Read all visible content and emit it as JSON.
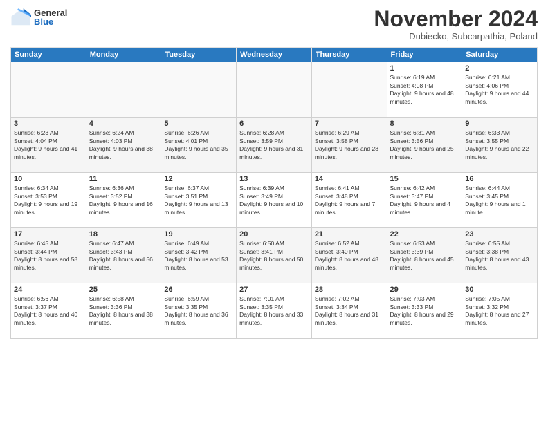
{
  "logo": {
    "general": "General",
    "blue": "Blue"
  },
  "title": "November 2024",
  "subtitle": "Dubiecko, Subcarpathia, Poland",
  "days_header": [
    "Sunday",
    "Monday",
    "Tuesday",
    "Wednesday",
    "Thursday",
    "Friday",
    "Saturday"
  ],
  "weeks": [
    [
      {
        "day": "",
        "content": ""
      },
      {
        "day": "",
        "content": ""
      },
      {
        "day": "",
        "content": ""
      },
      {
        "day": "",
        "content": ""
      },
      {
        "day": "",
        "content": ""
      },
      {
        "day": "1",
        "content": "Sunrise: 6:19 AM\nSunset: 4:08 PM\nDaylight: 9 hours and 48 minutes."
      },
      {
        "day": "2",
        "content": "Sunrise: 6:21 AM\nSunset: 4:06 PM\nDaylight: 9 hours and 44 minutes."
      }
    ],
    [
      {
        "day": "3",
        "content": "Sunrise: 6:23 AM\nSunset: 4:04 PM\nDaylight: 9 hours and 41 minutes."
      },
      {
        "day": "4",
        "content": "Sunrise: 6:24 AM\nSunset: 4:03 PM\nDaylight: 9 hours and 38 minutes."
      },
      {
        "day": "5",
        "content": "Sunrise: 6:26 AM\nSunset: 4:01 PM\nDaylight: 9 hours and 35 minutes."
      },
      {
        "day": "6",
        "content": "Sunrise: 6:28 AM\nSunset: 3:59 PM\nDaylight: 9 hours and 31 minutes."
      },
      {
        "day": "7",
        "content": "Sunrise: 6:29 AM\nSunset: 3:58 PM\nDaylight: 9 hours and 28 minutes."
      },
      {
        "day": "8",
        "content": "Sunrise: 6:31 AM\nSunset: 3:56 PM\nDaylight: 9 hours and 25 minutes."
      },
      {
        "day": "9",
        "content": "Sunrise: 6:33 AM\nSunset: 3:55 PM\nDaylight: 9 hours and 22 minutes."
      }
    ],
    [
      {
        "day": "10",
        "content": "Sunrise: 6:34 AM\nSunset: 3:53 PM\nDaylight: 9 hours and 19 minutes."
      },
      {
        "day": "11",
        "content": "Sunrise: 6:36 AM\nSunset: 3:52 PM\nDaylight: 9 hours and 16 minutes."
      },
      {
        "day": "12",
        "content": "Sunrise: 6:37 AM\nSunset: 3:51 PM\nDaylight: 9 hours and 13 minutes."
      },
      {
        "day": "13",
        "content": "Sunrise: 6:39 AM\nSunset: 3:49 PM\nDaylight: 9 hours and 10 minutes."
      },
      {
        "day": "14",
        "content": "Sunrise: 6:41 AM\nSunset: 3:48 PM\nDaylight: 9 hours and 7 minutes."
      },
      {
        "day": "15",
        "content": "Sunrise: 6:42 AM\nSunset: 3:47 PM\nDaylight: 9 hours and 4 minutes."
      },
      {
        "day": "16",
        "content": "Sunrise: 6:44 AM\nSunset: 3:45 PM\nDaylight: 9 hours and 1 minute."
      }
    ],
    [
      {
        "day": "17",
        "content": "Sunrise: 6:45 AM\nSunset: 3:44 PM\nDaylight: 8 hours and 58 minutes."
      },
      {
        "day": "18",
        "content": "Sunrise: 6:47 AM\nSunset: 3:43 PM\nDaylight: 8 hours and 56 minutes."
      },
      {
        "day": "19",
        "content": "Sunrise: 6:49 AM\nSunset: 3:42 PM\nDaylight: 8 hours and 53 minutes."
      },
      {
        "day": "20",
        "content": "Sunrise: 6:50 AM\nSunset: 3:41 PM\nDaylight: 8 hours and 50 minutes."
      },
      {
        "day": "21",
        "content": "Sunrise: 6:52 AM\nSunset: 3:40 PM\nDaylight: 8 hours and 48 minutes."
      },
      {
        "day": "22",
        "content": "Sunrise: 6:53 AM\nSunset: 3:39 PM\nDaylight: 8 hours and 45 minutes."
      },
      {
        "day": "23",
        "content": "Sunrise: 6:55 AM\nSunset: 3:38 PM\nDaylight: 8 hours and 43 minutes."
      }
    ],
    [
      {
        "day": "24",
        "content": "Sunrise: 6:56 AM\nSunset: 3:37 PM\nDaylight: 8 hours and 40 minutes."
      },
      {
        "day": "25",
        "content": "Sunrise: 6:58 AM\nSunset: 3:36 PM\nDaylight: 8 hours and 38 minutes."
      },
      {
        "day": "26",
        "content": "Sunrise: 6:59 AM\nSunset: 3:35 PM\nDaylight: 8 hours and 36 minutes."
      },
      {
        "day": "27",
        "content": "Sunrise: 7:01 AM\nSunset: 3:35 PM\nDaylight: 8 hours and 33 minutes."
      },
      {
        "day": "28",
        "content": "Sunrise: 7:02 AM\nSunset: 3:34 PM\nDaylight: 8 hours and 31 minutes."
      },
      {
        "day": "29",
        "content": "Sunrise: 7:03 AM\nSunset: 3:33 PM\nDaylight: 8 hours and 29 minutes."
      },
      {
        "day": "30",
        "content": "Sunrise: 7:05 AM\nSunset: 3:32 PM\nDaylight: 8 hours and 27 minutes."
      }
    ]
  ]
}
